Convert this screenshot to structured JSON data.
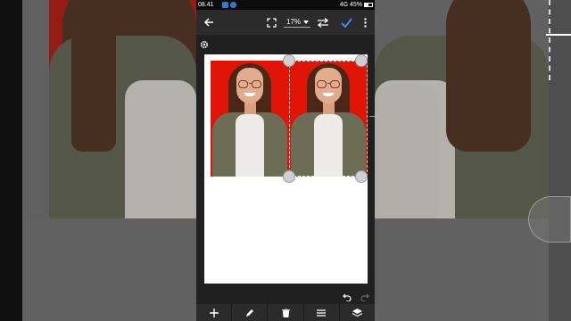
{
  "status_bar": {
    "time": "08.41",
    "right_text": "4G 45%"
  },
  "toolbar": {
    "zoom_level": "17%",
    "icons": [
      "back-arrow-icon",
      "fit-screen-icon",
      "swap-icon",
      "confirm-check-icon",
      "more-vert-icon"
    ]
  },
  "canvas": {
    "background": "#ffffff",
    "photo_background": "#e01508",
    "photo_count": 2
  },
  "bottom_bar": {
    "icons": [
      "add-icon",
      "edit-icon",
      "delete-icon",
      "menu-icon",
      "layers-icon"
    ]
  },
  "colors": {
    "accent": "#4a8fff",
    "toolbar": "#2b2b2b",
    "workspace": "#202020"
  }
}
